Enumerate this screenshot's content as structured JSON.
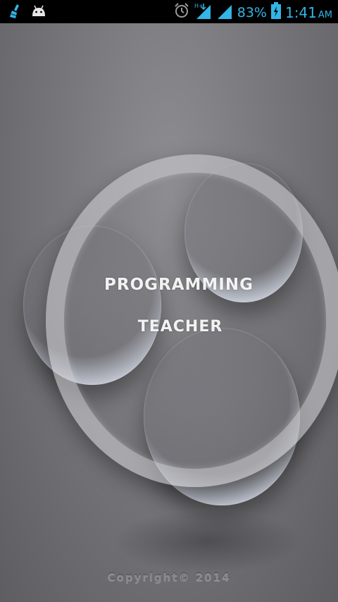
{
  "status_bar": {
    "battery_percent": "83%",
    "time": "1:41",
    "ampm": "AM",
    "accent_color": "#33b5e5",
    "icons": [
      "broom-notification-icon",
      "android-notification-icon",
      "alarm-icon",
      "hplus-signal-icon",
      "cell-signal-icon",
      "battery-charging-icon"
    ]
  },
  "splash": {
    "title_line1": "PROGRAMMING",
    "title_line2": "TEACHER",
    "copyright": "Copyright© 2014"
  }
}
